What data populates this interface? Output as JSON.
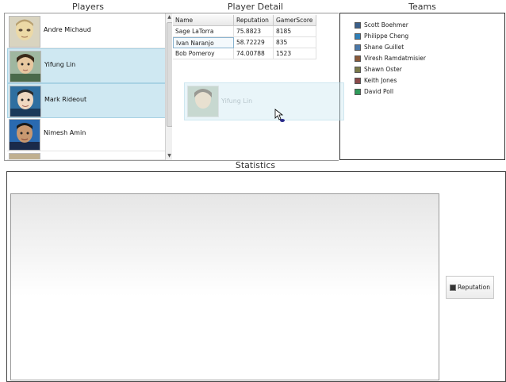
{
  "sections": {
    "players": "Players",
    "player_detail": "Player Detail",
    "teams": "Teams",
    "statistics": "Statistics"
  },
  "players": [
    {
      "name": "Andre Michaud",
      "selected": false
    },
    {
      "name": "Yifung Lin",
      "selected": true
    },
    {
      "name": "Mark Rideout",
      "selected": true
    },
    {
      "name": "Nimesh Amin",
      "selected": false
    }
  ],
  "detail": {
    "columns": [
      "Name",
      "Reputation",
      "GamerScore"
    ],
    "rows": [
      [
        "Sage LaTorra",
        "75.8823",
        "8185"
      ],
      [
        "Ivan Naranjo",
        "58.72229",
        "835"
      ],
      [
        "Bob Pomeroy",
        "74.00788",
        "1523"
      ]
    ]
  },
  "teams": [
    {
      "name": "Scott Boehmer",
      "color": "#3b5f8a"
    },
    {
      "name": "Philippe Cheng",
      "color": "#2f7fb8"
    },
    {
      "name": "Shane Guillet",
      "color": "#4a78a8"
    },
    {
      "name": "Viresh Ramdatmisier",
      "color": "#8a5a3a"
    },
    {
      "name": "Shawn Oster",
      "color": "#7a7a4a"
    },
    {
      "name": "Keith Jones",
      "color": "#8a4a4a"
    },
    {
      "name": "David Poll",
      "color": "#2f9a5a"
    }
  ],
  "drag": {
    "label": "Yifung Lin"
  },
  "statistics": {
    "legend_label": "Reputation"
  },
  "icons": {
    "scroll_up": "triangle-up-icon",
    "scroll_down": "triangle-down-icon",
    "cursor": "mouse-pointer-icon",
    "legend": "legend-swatch-icon"
  }
}
